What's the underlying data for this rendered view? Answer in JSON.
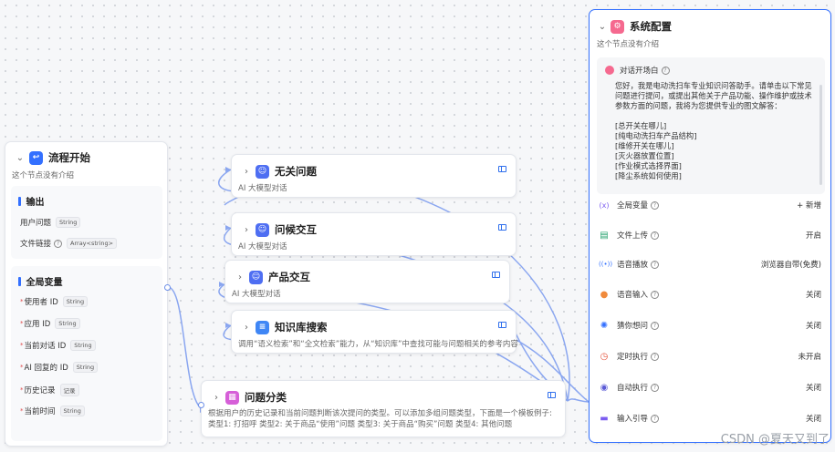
{
  "start_node": {
    "title": "流程开始",
    "desc": "这个节点没有介绍",
    "output": {
      "label": "输出",
      "items": [
        {
          "name": "用户问题",
          "type": "String"
        },
        {
          "name": "文件链接",
          "type": "Array<string>"
        }
      ]
    },
    "globals": {
      "label": "全局变量",
      "items": [
        {
          "name": "使用者 ID",
          "type": "String"
        },
        {
          "name": "应用 ID",
          "type": "String"
        },
        {
          "name": "当前对话 ID",
          "type": "String"
        },
        {
          "name": "AI 回复的 ID",
          "type": "String"
        },
        {
          "name": "历史记录",
          "type": "记录"
        },
        {
          "name": "当前时间",
          "type": "String"
        }
      ]
    }
  },
  "nodes": [
    {
      "title": "无关问题",
      "desc": "AI 大模型对话"
    },
    {
      "title": "问候交互",
      "desc": "AI 大模型对话"
    },
    {
      "title": "产品交互",
      "desc": "AI 大模型对话"
    },
    {
      "title": "知识库搜索",
      "desc": "调用“语义检索”和“全文检索”能力，从“知识库”中查找可能与问题相关的参考内容"
    }
  ],
  "classify_node": {
    "title": "问题分类",
    "desc": "根据用户的历史记录和当前问题判断该次提问的类型。可以添加多组问题类型，下面是一个模板例子: 类型1: 打招呼 类型2: 关于商品“使用”问题 类型3: 关于商品“购买”问题 类型4: 其他问题"
  },
  "system_config": {
    "title": "系统配置",
    "desc": "这个节点没有介绍",
    "opening": {
      "label": "对话开场白",
      "text": "您好，我是电动洗扫车专业知识问答助手。请单击以下常见问题进行提问，或提出其他关于产品功能、操作维护或技术参数方面的问题，我将为您提供专业的图文解答：\n\n[总开关在哪儿]\n[纯电动洗扫车产品结构]\n[维修开关在哪儿]\n[灭火器放置位置]\n[作业模式选择界面]\n[降尘系统如何使用]"
    },
    "rows": [
      {
        "icon": "variable-icon",
        "glyph": "(x)",
        "color": "#7b5cf0",
        "label": "全局变量",
        "value": "+ 新增"
      },
      {
        "icon": "file-upload-icon",
        "glyph": "▤",
        "color": "#22a06b",
        "label": "文件上传",
        "value": "开启"
      },
      {
        "icon": "voice-play-icon",
        "glyph": "((•))",
        "color": "#3370ff",
        "label": "语音播放",
        "value": "浏览器自带(免费)"
      },
      {
        "icon": "microphone-icon",
        "glyph": "●",
        "color": "#f08a3c",
        "label": "语音输入",
        "value": "关闭"
      },
      {
        "icon": "lightbulb-icon",
        "glyph": "✺",
        "color": "#3370ff",
        "label": "猜你想问",
        "value": "关闭"
      },
      {
        "icon": "timer-icon",
        "glyph": "◷",
        "color": "#e5533d",
        "label": "定时执行",
        "value": "未开启"
      },
      {
        "icon": "auto-run-icon",
        "glyph": "◉",
        "color": "#5b5bd6",
        "label": "自动执行",
        "value": "关闭"
      },
      {
        "icon": "input-guide-icon",
        "glyph": "▬",
        "color": "#7b5cf0",
        "label": "输入引导",
        "value": "关闭"
      }
    ]
  },
  "watermark": "CSDN @夏天又到了",
  "colors": {
    "accent": "#3370ff",
    "edge": "#7b9ef0"
  }
}
